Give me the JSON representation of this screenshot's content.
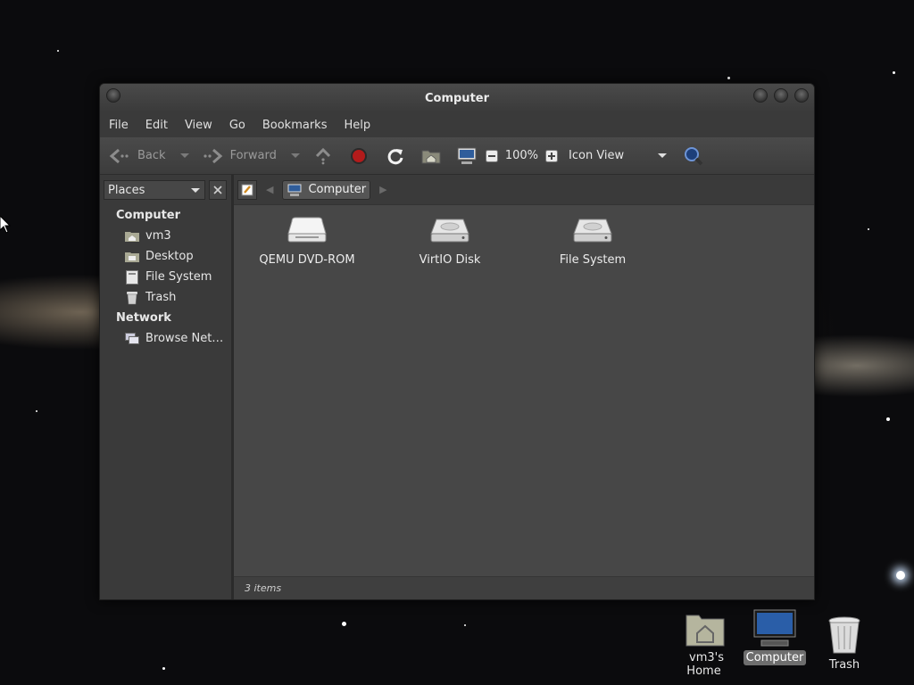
{
  "window": {
    "title": "Computer"
  },
  "menubar": [
    "File",
    "Edit",
    "View",
    "Go",
    "Bookmarks",
    "Help"
  ],
  "toolbar": {
    "back_label": "Back",
    "forward_label": "Forward",
    "zoom": "100%",
    "view_mode": "Icon View"
  },
  "sidebar": {
    "combo_label": "Places",
    "sections": [
      {
        "heading": "Computer",
        "items": [
          {
            "label": "vm3",
            "icon": "home-folder-icon"
          },
          {
            "label": "Desktop",
            "icon": "desktop-folder-icon"
          },
          {
            "label": "File System",
            "icon": "filesystem-icon"
          },
          {
            "label": "Trash",
            "icon": "trash-icon"
          }
        ]
      },
      {
        "heading": "Network",
        "items": [
          {
            "label": "Browse Net…",
            "icon": "network-icon"
          }
        ]
      }
    ]
  },
  "pathbar": {
    "current": "Computer"
  },
  "files": [
    {
      "label": "QEMU DVD-ROM",
      "icon": "optical-drive-icon"
    },
    {
      "label": "VirtIO Disk",
      "icon": "hard-disk-icon"
    },
    {
      "label": "File System",
      "icon": "hard-disk-icon"
    }
  ],
  "status": "3 items",
  "desktop": [
    {
      "label": "vm3's Home",
      "icon": "home-folder-icon"
    },
    {
      "label": "Computer",
      "icon": "computer-icon"
    },
    {
      "label": "Trash",
      "icon": "trash-icon"
    }
  ]
}
